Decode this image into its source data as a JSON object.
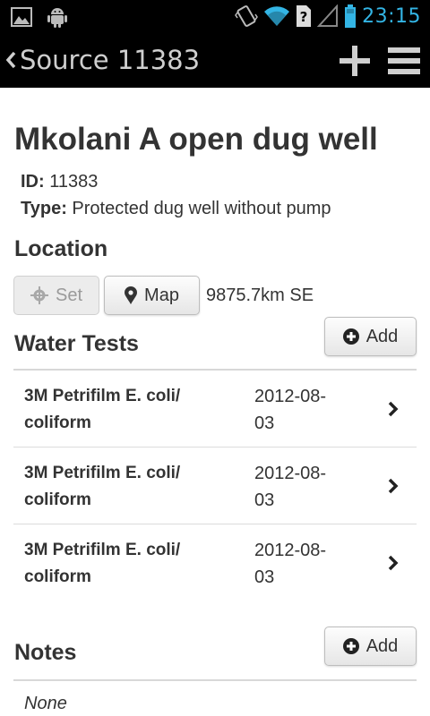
{
  "status": {
    "time": "23:15"
  },
  "actionbar": {
    "title": "Source 11383"
  },
  "source": {
    "name": "Mkolani A open dug well",
    "id_label": "ID:",
    "id_value": "11383",
    "type_label": "Type:",
    "type_value": "Protected dug well without pump"
  },
  "location": {
    "heading": "Location",
    "set_label": "Set",
    "map_label": "Map",
    "distance": "9875.7km SE"
  },
  "water_tests": {
    "heading": "Water Tests",
    "add_label": "Add",
    "items": [
      {
        "name_line1": "3M Petrifilm E. coli/",
        "name_line2": "coliform",
        "date_line1": "2012-08-",
        "date_line2": "03"
      },
      {
        "name_line1": "3M Petrifilm E. coli/",
        "name_line2": "coliform",
        "date_line1": "2012-08-",
        "date_line2": "03"
      },
      {
        "name_line1": "3M Petrifilm E. coli/",
        "name_line2": "coliform",
        "date_line1": "2012-08-",
        "date_line2": "03"
      }
    ]
  },
  "notes": {
    "heading": "Notes",
    "add_label": "Add",
    "value": "None"
  },
  "colors": {
    "status_time": "#33b5e5",
    "bar_bg": "#000000"
  }
}
